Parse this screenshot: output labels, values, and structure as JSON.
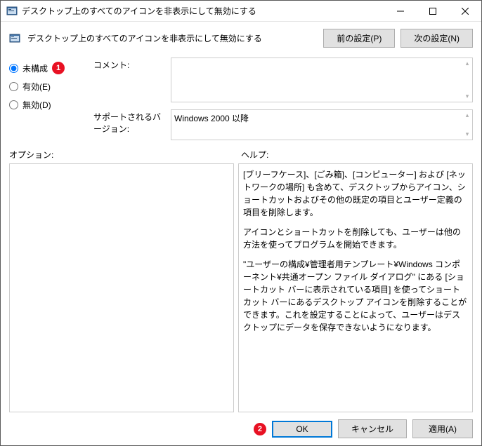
{
  "window": {
    "title": "デスクトップ上のすべてのアイコンを非表示にして無効にする"
  },
  "header": {
    "title": "デスクトップ上のすべてのアイコンを非表示にして無効にする",
    "prev_setting": "前の設定(P)",
    "next_setting": "次の設定(N)"
  },
  "radios": {
    "not_configured": "未構成",
    "enabled": "有効(E)",
    "disabled": "無効(D)"
  },
  "badges": {
    "one": "1",
    "two": "2"
  },
  "fields": {
    "comment_label": "コメント:",
    "comment_value": "",
    "supported_label": "サポートされるバージョン:",
    "supported_value": "Windows 2000 以降"
  },
  "labels": {
    "options": "オプション:",
    "help": "ヘルプ:"
  },
  "help": {
    "p1": "[ブリーフケース]、[ごみ箱]、[コンピューター] および [ネットワークの場所] も含めて、デスクトップからアイコン、ショートカットおよびその他の既定の項目とユーザー定義の項目を削除します。",
    "p2": "アイコンとショートカットを削除しても、ユーザーは他の方法を使ってプログラムを開始できます。",
    "p3": "\"ユーザーの構成¥管理者用テンプレート¥Windows コンポーネント¥共通オープン ファイル ダイアログ\" にある [ショートカット バーに表示されている項目] を使ってショートカット バーにあるデスクトップ アイコンを削除することができます。これを設定することによって、ユーザーはデスクトップにデータを保存できないようになります。"
  },
  "footer": {
    "ok": "OK",
    "cancel": "キャンセル",
    "apply": "適用(A)"
  }
}
